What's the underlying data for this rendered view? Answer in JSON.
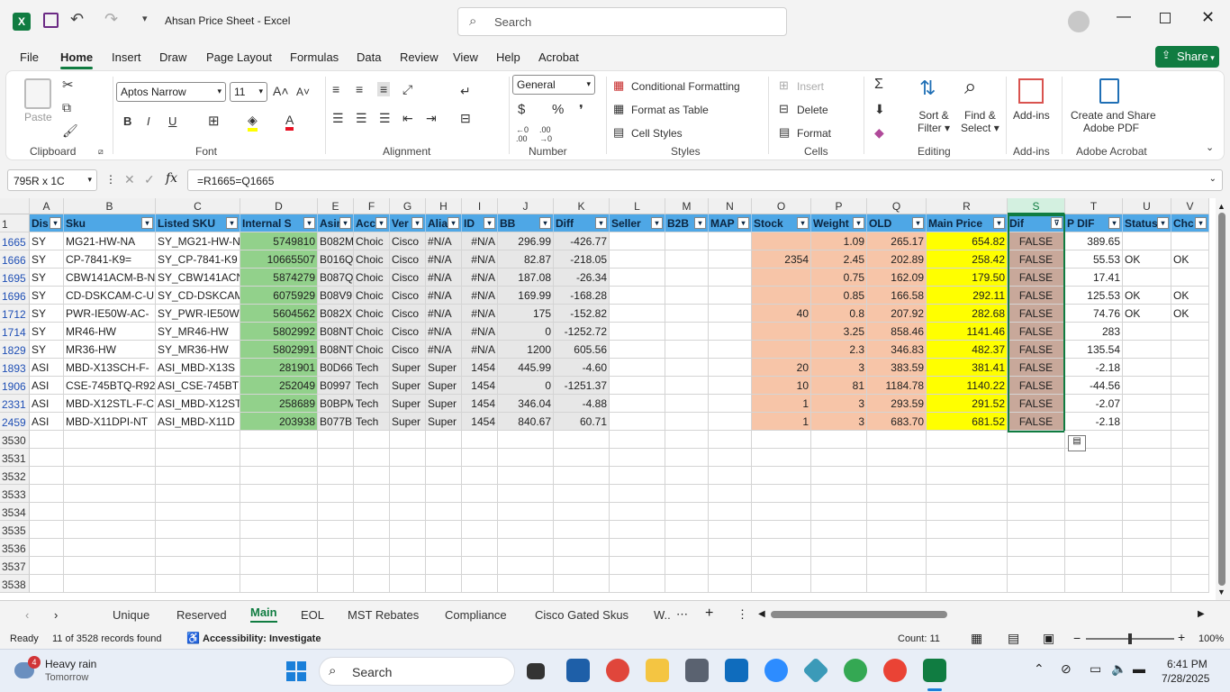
{
  "titlebar": {
    "title": "Ahsan Price Sheet  -  Excel",
    "search_placeholder": "Search"
  },
  "menu": [
    "File",
    "Home",
    "Insert",
    "Draw",
    "Page Layout",
    "Formulas",
    "Data",
    "Review",
    "View",
    "Help",
    "Acrobat"
  ],
  "share_label": "Share",
  "ribbon": {
    "clipboard": {
      "paste": "Paste",
      "group": "Clipboard"
    },
    "font": {
      "name": "Aptos Narrow",
      "size": "11",
      "group": "Font"
    },
    "alignment": {
      "group": "Alignment"
    },
    "number": {
      "format": "General",
      "group": "Number"
    },
    "styles": {
      "conditional": "Conditional Formatting",
      "format_table": "Format as Table",
      "cell_styles": "Cell Styles",
      "group": "Styles"
    },
    "cells": {
      "insert": "Insert",
      "delete": "Delete",
      "format": "Format",
      "group": "Cells"
    },
    "editing": {
      "sort": "Sort &",
      "filter": "Filter",
      "find": "Find &",
      "select": "Select",
      "group": "Editing"
    },
    "addins": {
      "label": "Add-ins",
      "group": "Add-ins"
    },
    "acrobat": {
      "line1": "Create and Share",
      "line2": "Adobe PDF",
      "group": "Adobe Acrobat"
    }
  },
  "formula_bar": {
    "name_box": "795R x 1C",
    "formula": "=R1665=Q1665"
  },
  "columns": [
    "A",
    "B",
    "C",
    "D",
    "E",
    "F",
    "G",
    "H",
    "I",
    "J",
    "K",
    "L",
    "M",
    "N",
    "O",
    "P",
    "Q",
    "R",
    "S",
    "T",
    "U",
    "V"
  ],
  "header_row": [
    "Dis",
    "Sku",
    "Listed SKU",
    "Internal S",
    "Asin",
    "Acc",
    "Ver",
    "Alia",
    "ID",
    "BB",
    "Diff",
    "Seller",
    "B2B",
    "MAP",
    "Stock",
    "Weight",
    "OLD",
    "Main Price",
    "Dif",
    "P DIF",
    "Status",
    "Chc"
  ],
  "rows": [
    {
      "n": "1665",
      "c": [
        "SY",
        "MG21-HW-NA",
        "SY_MG21-HW-N",
        "5749810",
        "B082M",
        "Choic",
        "Cisco",
        "#N/A",
        "#N/A",
        "296.99",
        "-426.77",
        "",
        "",
        "",
        "",
        "1.09",
        "265.17",
        "654.82",
        "FALSE",
        "389.65",
        "",
        ""
      ]
    },
    {
      "n": "1666",
      "c": [
        "SY",
        "CP-7841-K9=",
        "SY_CP-7841-K9",
        "10665507",
        "B016Q",
        "Choic",
        "Cisco",
        "#N/A",
        "#N/A",
        "82.87",
        "-218.05",
        "",
        "",
        "",
        "2354",
        "2.45",
        "202.89",
        "258.42",
        "FALSE",
        "55.53",
        "OK",
        "OK"
      ]
    },
    {
      "n": "1695",
      "c": [
        "SY",
        "CBW141ACM-B-N",
        "SY_CBW141ACN",
        "5874279",
        "B087Q",
        "Choic",
        "Cisco",
        "#N/A",
        "#N/A",
        "187.08",
        "-26.34",
        "",
        "",
        "",
        "",
        "0.75",
        "162.09",
        "179.50",
        "FALSE",
        "17.41",
        "",
        ""
      ]
    },
    {
      "n": "1696",
      "c": [
        "SY",
        "CD-DSKCAM-C-U",
        "SY_CD-DSKCAM",
        "6075929",
        "B08V9",
        "Choic",
        "Cisco",
        "#N/A",
        "#N/A",
        "169.99",
        "-168.28",
        "",
        "",
        "",
        "",
        "0.85",
        "166.58",
        "292.11",
        "FALSE",
        "125.53",
        "OK",
        "OK"
      ]
    },
    {
      "n": "1712",
      "c": [
        "SY",
        "PWR-IE50W-AC-",
        "SY_PWR-IE50W",
        "5604562",
        "B082X",
        "Choic",
        "Cisco",
        "#N/A",
        "#N/A",
        "175",
        "-152.82",
        "",
        "",
        "",
        "40",
        "0.8",
        "207.92",
        "282.68",
        "FALSE",
        "74.76",
        "OK",
        "OK"
      ]
    },
    {
      "n": "1714",
      "c": [
        "SY",
        "MR46-HW",
        "SY_MR46-HW",
        "5802992",
        "B08NT",
        "Choic",
        "Cisco",
        "#N/A",
        "#N/A",
        "0",
        "-1252.72",
        "",
        "",
        "",
        "",
        "3.25",
        "858.46",
        "1141.46",
        "FALSE",
        "283",
        "",
        ""
      ]
    },
    {
      "n": "1829",
      "c": [
        "SY",
        "MR36-HW",
        "SY_MR36-HW",
        "5802991",
        "B08NT",
        "Choic",
        "Cisco",
        "#N/A",
        "#N/A",
        "1200",
        "605.56",
        "",
        "",
        "",
        "",
        "2.3",
        "346.83",
        "482.37",
        "FALSE",
        "135.54",
        "",
        ""
      ]
    },
    {
      "n": "1893",
      "c": [
        "ASI",
        "MBD-X13SCH-F-",
        "ASI_MBD-X13S",
        "281901",
        "B0D66",
        "Tech",
        "Super",
        "Super",
        "1454",
        "445.99",
        "-4.60",
        "",
        "",
        "",
        "20",
        "3",
        "383.59",
        "381.41",
        "FALSE",
        "-2.18",
        "",
        ""
      ]
    },
    {
      "n": "1906",
      "c": [
        "ASI",
        "CSE-745BTQ-R92",
        "ASI_CSE-745BT",
        "252049",
        "B0997",
        "Tech",
        "Super",
        "Super",
        "1454",
        "0",
        "-1251.37",
        "",
        "",
        "",
        "10",
        "81",
        "1184.78",
        "1140.22",
        "FALSE",
        "-44.56",
        "",
        ""
      ]
    },
    {
      "n": "2331",
      "c": [
        "ASI",
        "MBD-X12STL-F-C",
        "ASI_MBD-X12ST",
        "258689",
        "B0BPM",
        "Tech",
        "Super",
        "Super",
        "1454",
        "346.04",
        "-4.88",
        "",
        "",
        "",
        "1",
        "3",
        "293.59",
        "291.52",
        "FALSE",
        "-2.07",
        "",
        ""
      ]
    },
    {
      "n": "2459",
      "c": [
        "ASI",
        "MBD-X11DPI-NT",
        "ASI_MBD-X11D",
        "203938",
        "B077B",
        "Tech",
        "Super",
        "Super",
        "1454",
        "840.67",
        "60.71",
        "",
        "",
        "",
        "1",
        "3",
        "683.70",
        "681.52",
        "FALSE",
        "-2.18",
        "",
        ""
      ]
    }
  ],
  "empty_rows": [
    "3530",
    "3531",
    "3532",
    "3533",
    "3534",
    "3535",
    "3536",
    "3537",
    "3538"
  ],
  "sheet_tabs": [
    "Unique",
    "Reserved",
    "Main",
    "EOL",
    "MST Rebates",
    "Compliance",
    "Cisco Gated Skus",
    "W..."
  ],
  "active_tab": "Main",
  "status": {
    "ready": "Ready",
    "records": "11 of 3528 records found",
    "accessibility": "Accessibility: Investigate",
    "count": "Count: 11",
    "zoom": "100%"
  },
  "taskbar": {
    "weather_temp": "4",
    "weather_main": "Heavy rain",
    "weather_sub": "Tomorrow",
    "search": "Search",
    "time": "6:41 PM",
    "date": "7/28/2025"
  },
  "colors": {
    "accent": "#107c41",
    "header_blue": "#4ea7e6",
    "green_fill": "#92d18b",
    "gray_fill": "#e7e7e7",
    "peach_fill": "#f7c5a8",
    "yellow_fill": "#ffff00",
    "brown_fill": "#c8a89a"
  }
}
